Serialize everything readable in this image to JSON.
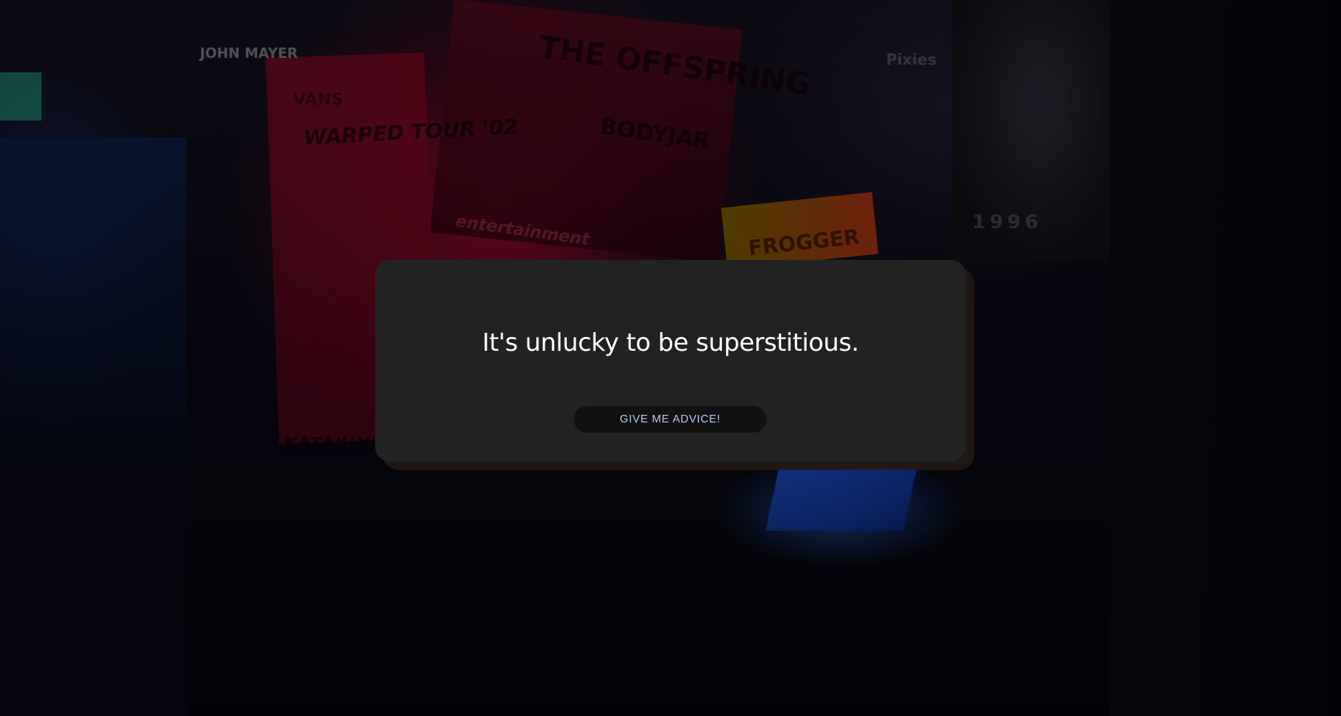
{
  "background": {
    "description_colors": {
      "primary_glow": "#aa0a2d",
      "secondary_glow": "#2868e6",
      "base": "#06060f"
    },
    "wall_texts": [
      "JOHN MAYER",
      "WARPED TOUR '02",
      "VANS",
      "THE OFFSPRING",
      "BODYJAR",
      "FROGGER",
      "Pixies",
      "KATAKLYSM",
      "entertainment",
      "1996"
    ]
  },
  "card": {
    "advice_text": "It's unlucky to be superstitious.",
    "button_label": "GIVE ME ADVICE!",
    "background_color": "#222222",
    "button_text_color": "#b9c6ff"
  }
}
